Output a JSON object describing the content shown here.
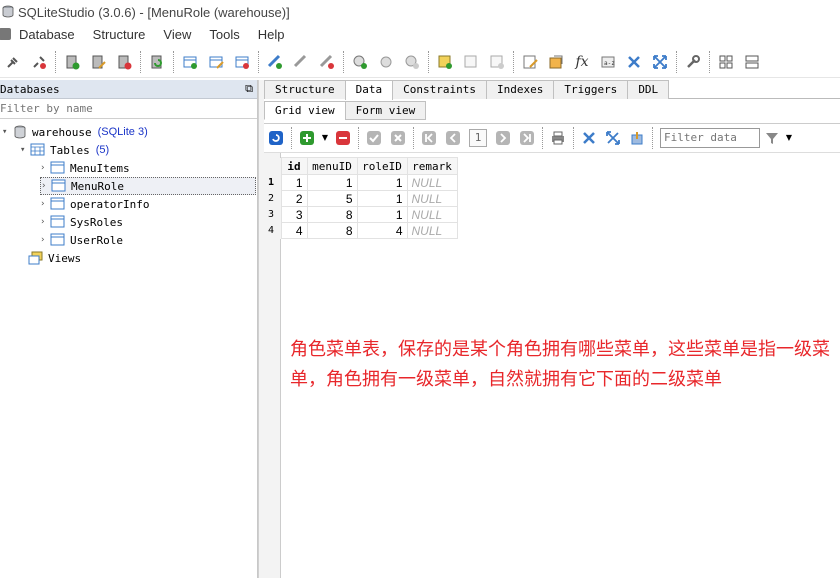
{
  "window": {
    "title": "SQLiteStudio (3.0.6) - [MenuRole (warehouse)]"
  },
  "menubar": [
    "Database",
    "Structure",
    "View",
    "Tools",
    "Help"
  ],
  "left_panel": {
    "title": "Databases",
    "float_icon": "⧉",
    "filter_placeholder": "Filter by name",
    "tree": {
      "database": {
        "name": "warehouse",
        "type": "(SQLite 3)"
      },
      "tables_label": "Tables",
      "tables_count": "(5)",
      "tables": [
        "MenuItems",
        "MenuRole",
        "operatorInfo",
        "SysRoles",
        "UserRole"
      ],
      "selected_table": "MenuRole",
      "views_label": "Views"
    }
  },
  "right_panel": {
    "tabs": [
      "Structure",
      "Data",
      "Constraints",
      "Indexes",
      "Triggers",
      "DDL"
    ],
    "active_tab": "Data",
    "subtabs": [
      "Grid view",
      "Form view"
    ],
    "active_subtab": "Grid view",
    "page_number": "1",
    "filter_placeholder": "Filter data",
    "grid": {
      "columns": [
        "id",
        "menuID",
        "roleID",
        "remark"
      ],
      "rows": [
        {
          "rownum": "1",
          "id": "1",
          "menuID": "1",
          "roleID": "1",
          "remark": "NULL"
        },
        {
          "rownum": "2",
          "id": "2",
          "menuID": "5",
          "roleID": "1",
          "remark": "NULL"
        },
        {
          "rownum": "3",
          "id": "3",
          "menuID": "8",
          "roleID": "1",
          "remark": "NULL"
        },
        {
          "rownum": "4",
          "id": "4",
          "menuID": "8",
          "roleID": "4",
          "remark": "NULL"
        }
      ]
    },
    "annotation": "角色菜单表，保存的是某个角色拥有哪些菜单，这些菜单是指一级菜单，角色拥有一级菜单，自然就拥有它下面的二级菜单"
  },
  "colors": {
    "accent_green": "#2f9a2f",
    "accent_red": "#d9363b",
    "accent_blue": "#1f63c7",
    "annotation_red": "#e8272b",
    "panel_header": "#dfe6f0"
  }
}
